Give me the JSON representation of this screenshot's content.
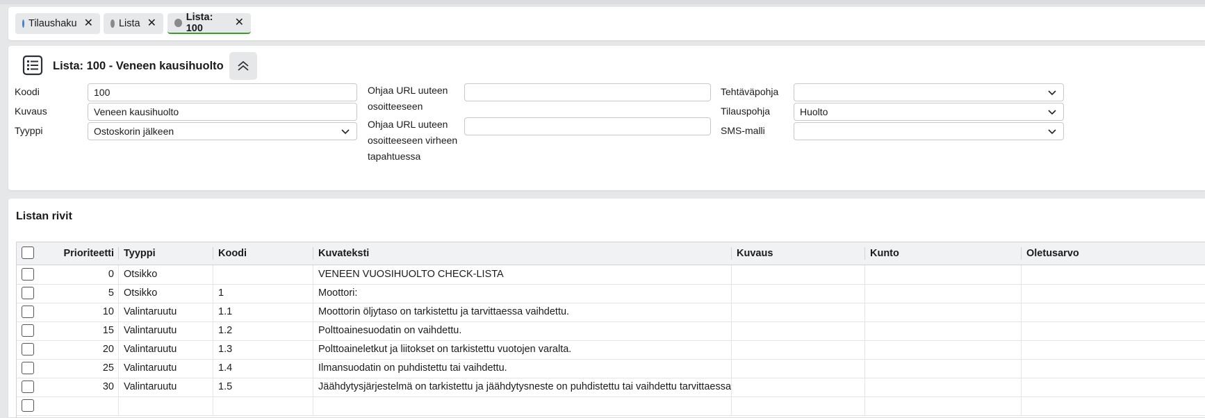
{
  "tabs": [
    {
      "label": "Tilaushaku",
      "dot_color": "#4a7fc1"
    },
    {
      "label": "Lista",
      "dot_color": "#8a8a8a"
    },
    {
      "label": "Lista: 100",
      "dot_color": "#8a8a8a"
    }
  ],
  "tab_close": "✕",
  "header": {
    "title": "Lista: 100 - Veneen kausihuolto",
    "fields": {
      "koodi": {
        "label": "Koodi",
        "value": "100"
      },
      "kuvaus": {
        "label": "Kuvaus",
        "value": "Veneen kausihuolto"
      },
      "tyyppi": {
        "label": "Tyyppi",
        "value": "Ostoskorin jälkeen"
      },
      "redirect_url": {
        "label_line1": "Ohjaa URL uuteen",
        "label_line2": "osoitteeseen",
        "value": ""
      },
      "redirect_error_url": {
        "label_line1": "Ohjaa URL uuteen",
        "label_line2": "osoitteeseen virheen",
        "label_line3": "tapahtuessa",
        "value": ""
      },
      "tehtavapohja": {
        "label": "Tehtäväpohja",
        "value": ""
      },
      "tilauspohja": {
        "label": "Tilauspohja",
        "value": "Huolto"
      },
      "sms_malli": {
        "label": "SMS-malli",
        "value": ""
      }
    }
  },
  "lines": {
    "title": "Listan rivit",
    "columns": [
      "Prioriteetti",
      "Tyyppi",
      "Koodi",
      "Kuvateksti",
      "Kuvaus",
      "Kunto",
      "Oletusarvo"
    ],
    "rows": [
      {
        "prioriteetti": "0",
        "tyyppi": "Otsikko",
        "koodi": "",
        "kuvateksti": "VENEEN VUOSIHUOLTO CHECK-LISTA",
        "kuvaus": "",
        "kunto": "",
        "oletusarvo": ""
      },
      {
        "prioriteetti": "5",
        "tyyppi": "Otsikko",
        "koodi": "1",
        "kuvateksti": "Moottori:",
        "kuvaus": "",
        "kunto": "",
        "oletusarvo": ""
      },
      {
        "prioriteetti": "10",
        "tyyppi": "Valintaruutu",
        "koodi": "1.1",
        "kuvateksti": "Moottorin öljytaso on tarkistettu ja tarvittaessa vaihdettu.",
        "kuvaus": "",
        "kunto": "",
        "oletusarvo": ""
      },
      {
        "prioriteetti": "15",
        "tyyppi": "Valintaruutu",
        "koodi": "1.2",
        "kuvateksti": "Polttoainesuodatin on vaihdettu.",
        "kuvaus": "",
        "kunto": "",
        "oletusarvo": ""
      },
      {
        "prioriteetti": "20",
        "tyyppi": "Valintaruutu",
        "koodi": "1.3",
        "kuvateksti": "Polttoaineletkut ja liitokset on tarkistettu vuotojen varalta.",
        "kuvaus": "",
        "kunto": "",
        "oletusarvo": ""
      },
      {
        "prioriteetti": "25",
        "tyyppi": "Valintaruutu",
        "koodi": "1.4",
        "kuvateksti": "Ilmansuodatin on puhdistettu tai vaihdettu.",
        "kuvaus": "",
        "kunto": "",
        "oletusarvo": ""
      },
      {
        "prioriteetti": "30",
        "tyyppi": "Valintaruutu",
        "koodi": "1.5",
        "kuvateksti": "Jäähdytysjärjestelmä on tarkistettu ja jäähdytysneste on puhdistettu tai vaihdettu tarvittaessa.",
        "kuvaus": "",
        "kunto": "",
        "oletusarvo": ""
      },
      {
        "prioriteetti": "",
        "tyyppi": "",
        "koodi": "",
        "kuvateksti": "",
        "kuvaus": "",
        "kunto": "",
        "oletusarvo": ""
      }
    ]
  },
  "colors": {
    "accent_green": "#3a9d2a",
    "tab_bg": "#e7e8ea",
    "header_bg": "#f1f2f4"
  }
}
